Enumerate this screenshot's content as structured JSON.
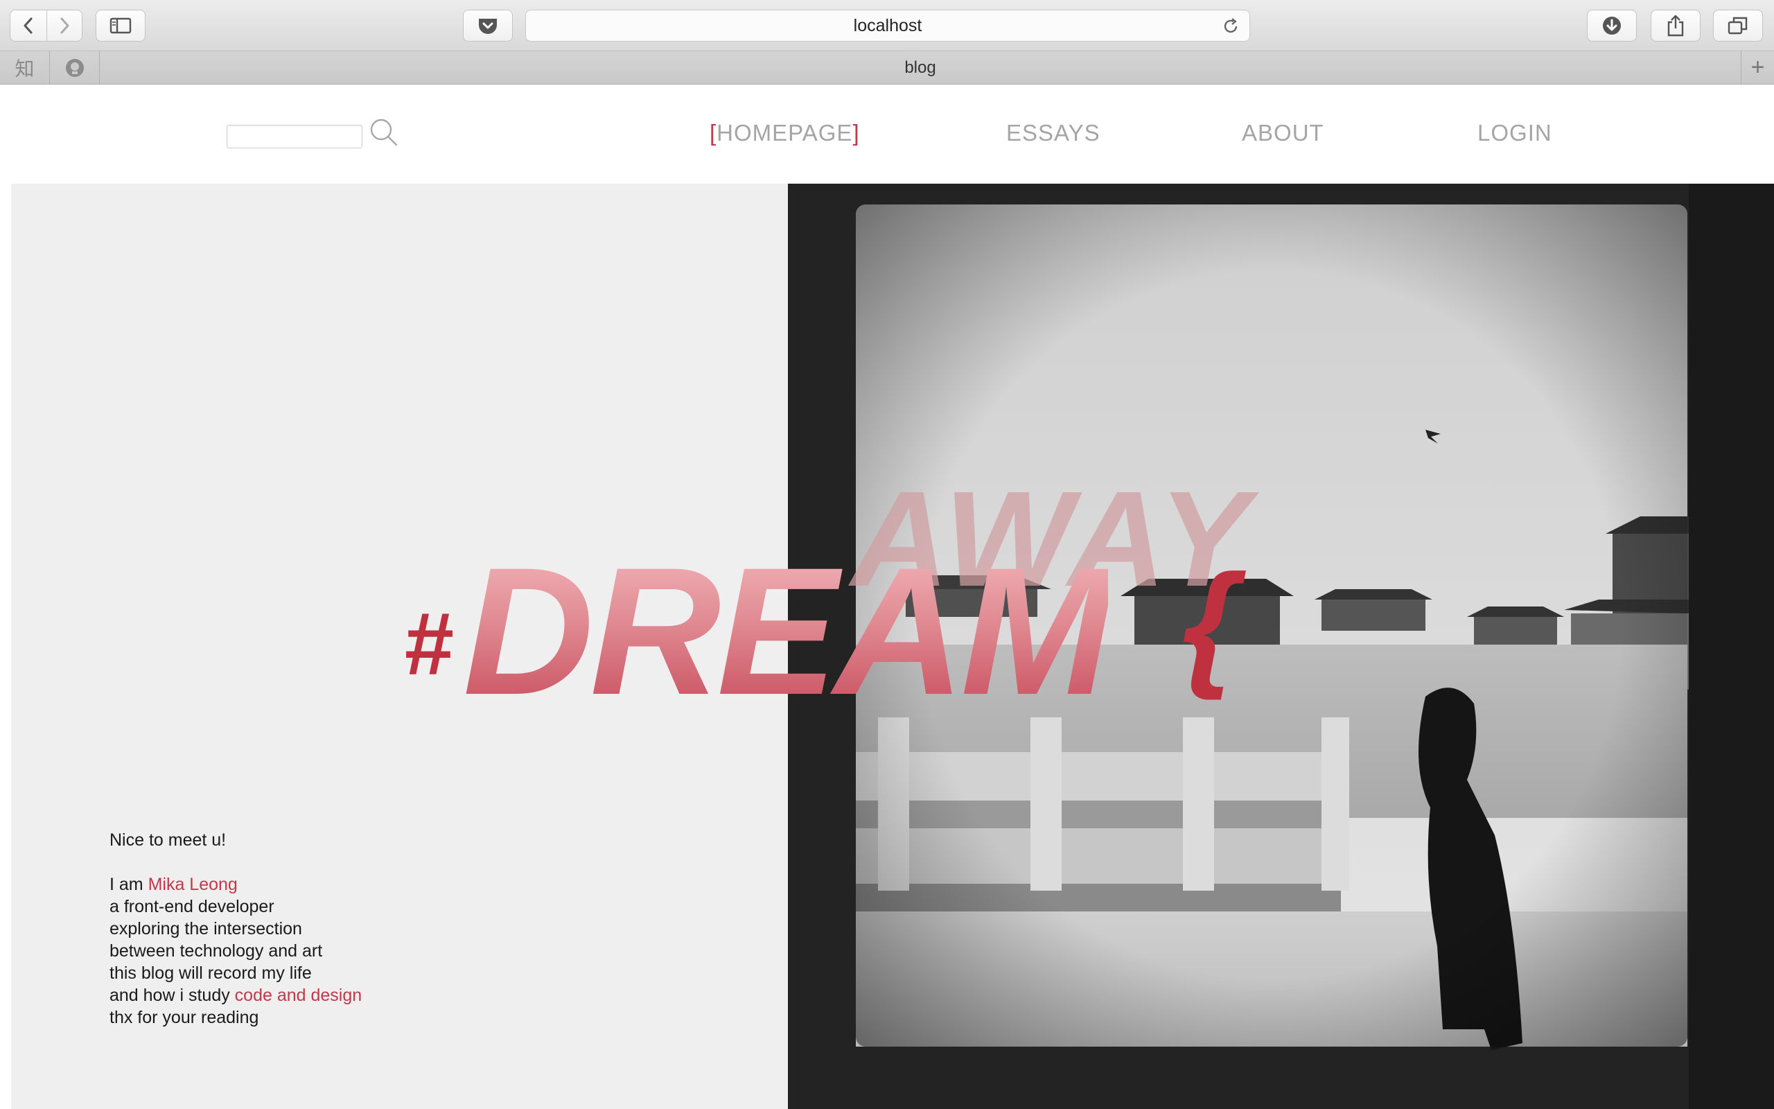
{
  "browser": {
    "url": "localhost",
    "tab_title": "blog",
    "pinned_tabs": [
      {
        "icon": "zhihu-icon",
        "glyph": "知"
      },
      {
        "icon": "github-icon",
        "glyph": ""
      }
    ],
    "new_tab_glyph": "+"
  },
  "header": {
    "nav": {
      "homepage_open": "[",
      "homepage": "HOMEPAGE",
      "homepage_close": "]",
      "essays": "ESSAYS",
      "about": "ABOUT",
      "login": "LOGIN"
    },
    "search_icon": "search-icon"
  },
  "hero": {
    "away": "AWAY",
    "hash": "#",
    "dream": "DREAM",
    "brace": "{",
    "intro": {
      "greeting": "Nice to meet u!",
      "iam": "I am ",
      "name": "Mika Leong",
      "line1": "a front-end developer",
      "line2": "exploring the intersection",
      "line3": "between technology and art",
      "line4": "this blog will record my life",
      "line5_prefix": "and how i study ",
      "line5_link": "code and design",
      "line6": "thx for your reading"
    }
  },
  "colors": {
    "accent": "#c0394b",
    "nav_text": "#a5a5a5",
    "panel_bg": "#efefef"
  }
}
